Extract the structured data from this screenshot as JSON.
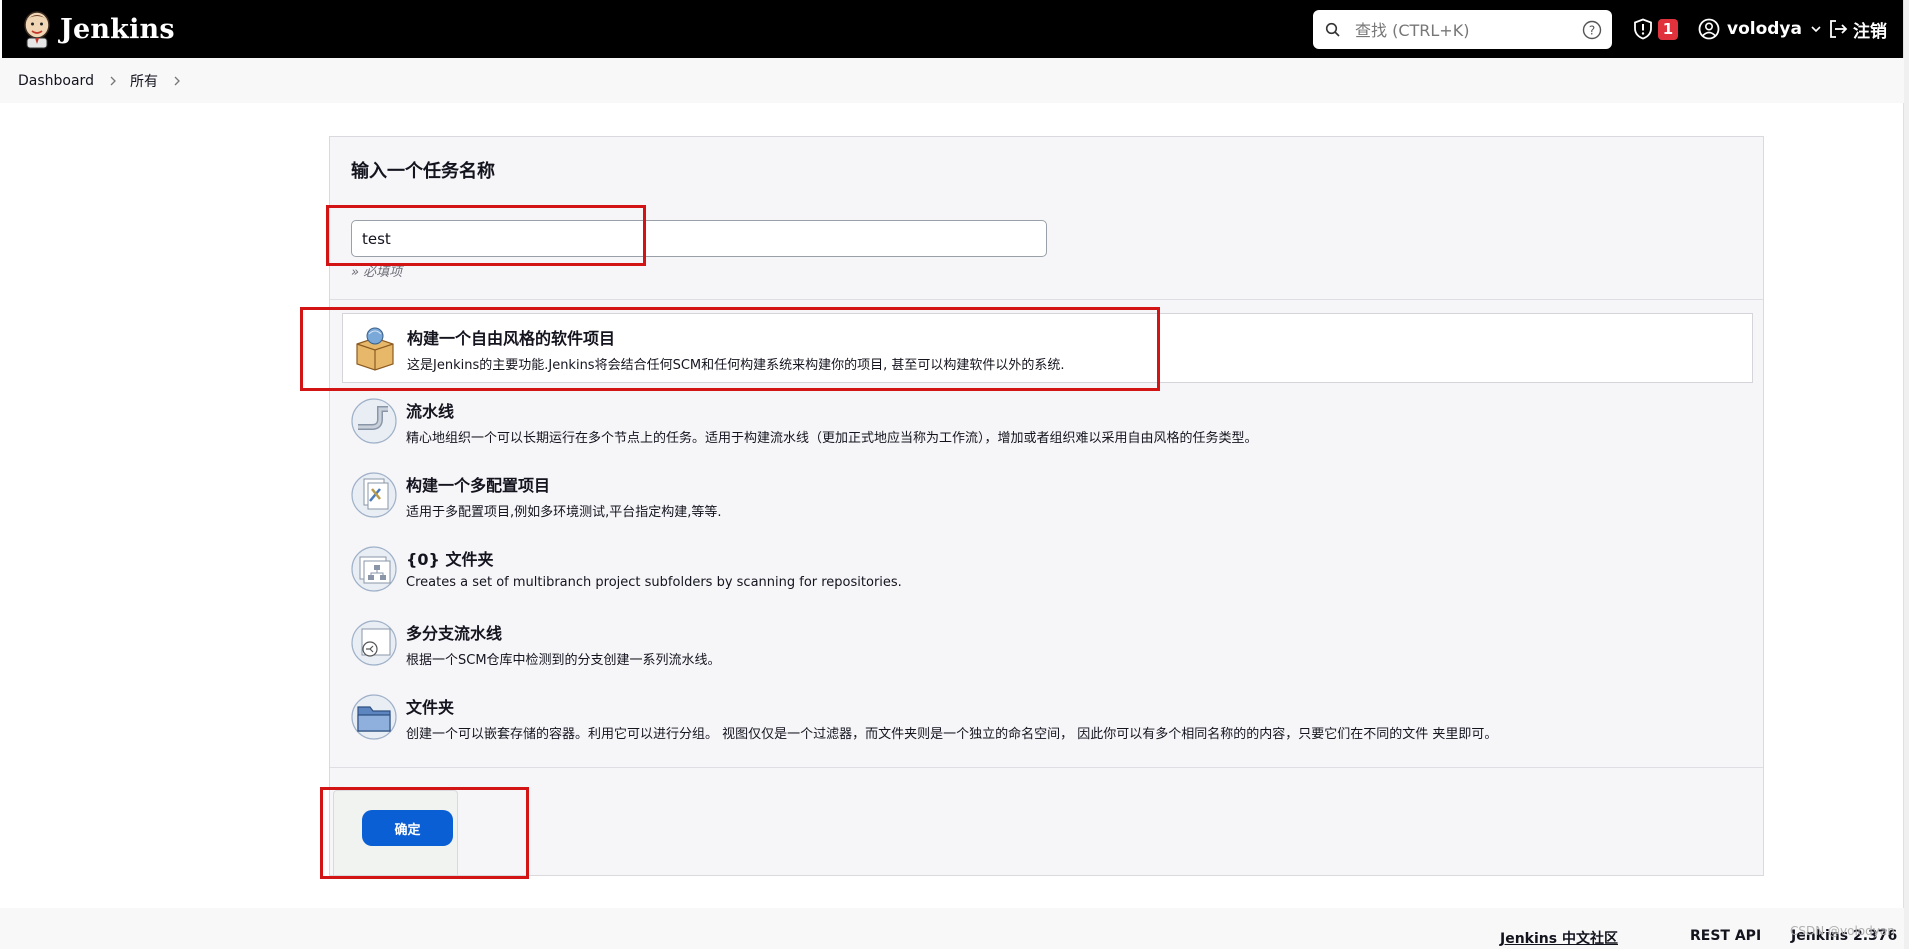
{
  "header": {
    "brand": "Jenkins",
    "search_placeholder": "查找 (CTRL+K)",
    "security_badge_count": "1",
    "user_name": "volodya",
    "logout_label": "注销"
  },
  "breadcrumbs": [
    "Dashboard",
    "所有"
  ],
  "form": {
    "name_title": "输入一个任务名称",
    "name_value": "test",
    "required_hint": "» 必填项"
  },
  "item_types": [
    {
      "icon": "freestyle-box-icon",
      "title": "构建一个自由风格的软件项目",
      "desc": "这是Jenkins的主要功能.Jenkins将会结合任何SCM和任何构建系统来构建你的项目, 甚至可以构建软件以外的系统.",
      "selected": true
    },
    {
      "icon": "pipeline-icon",
      "title": "流水线",
      "desc": "精心地组织一个可以长期运行在多个节点上的任务。适用于构建流水线（更加正式地应当称为工作流），增加或者组织难以采用自由风格的任务类型。",
      "selected": false
    },
    {
      "icon": "multi-config-icon",
      "title": "构建一个多配置项目",
      "desc": "适用于多配置项目,例如多环境测试,平台指定构建,等等.",
      "selected": false
    },
    {
      "icon": "org-folder-icon",
      "title": "{0} 文件夹",
      "desc": "Creates a set of multibranch project subfolders by scanning for repositories.",
      "selected": false
    },
    {
      "icon": "multibranch-pipeline-icon",
      "title": "多分支流水线",
      "desc": "根据一个SCM仓库中检测到的分支创建一系列流水线。",
      "selected": false
    },
    {
      "icon": "folder-icon",
      "title": "文件夹",
      "desc": "创建一个可以嵌套存储的容器。利用它可以进行分组。 视图仅仅是一个过滤器，而文件夹则是一个独立的命名空间， 因此你可以有多个相同名称的的内容，只要它们在不同的文件 夹里即可。",
      "selected": false
    }
  ],
  "ok_label": "确定",
  "footer": {
    "community": "Jenkins 中文社区",
    "rest_api": "REST API",
    "version": "Jenkins 2.376",
    "watermark": "CSDN @volodyan"
  },
  "colors": {
    "header_bg": "#000000",
    "accent": "#0b5fd4",
    "badge": "#e0323c",
    "highlight": "#d21414"
  }
}
